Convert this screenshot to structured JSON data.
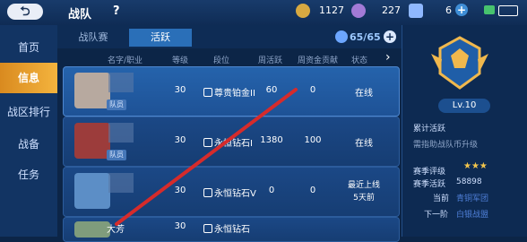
{
  "header": {
    "back_icon": "back-arrow-icon",
    "title": "战队",
    "help": "?",
    "gold": "1127",
    "gems": "227",
    "tickets": "6",
    "gold_icon": "coin-icon",
    "gem_icon": "diamond-icon",
    "ticket_icon": "card-icon",
    "plus": "+"
  },
  "sidebar": {
    "items": [
      {
        "label": "首页"
      },
      {
        "label": "信息"
      },
      {
        "label": "战区排行"
      },
      {
        "label": "战备"
      },
      {
        "label": "任务"
      }
    ]
  },
  "tabs": {
    "items": [
      {
        "label": "战队赛"
      },
      {
        "label": "活跃"
      }
    ],
    "member_count": "65/65"
  },
  "table": {
    "headers": [
      "名字/职业",
      "等级",
      "段位",
      "周活跃",
      "周资金贡献",
      "状态"
    ],
    "rows": [
      {
        "badge": "队员",
        "level": "30",
        "rank": "尊贵铂金II",
        "active": "60",
        "fund": "0",
        "status": "在线"
      },
      {
        "badge": "队员",
        "level": "30",
        "rank": "永恒钻石I",
        "active": "1380",
        "fund": "100",
        "status": "在线"
      },
      {
        "badge": "",
        "level": "30",
        "rank": "永恒钻石V",
        "active": "0",
        "fund": "0",
        "status_line1": "最近上线",
        "status_line2": "5天前"
      },
      {
        "name": "大芳",
        "level": "30",
        "rank": "永恒钻石",
        "active": "",
        "fund": "",
        "status": ""
      }
    ]
  },
  "right_panel": {
    "level": "Lv.10",
    "accum_label": "累计活跃",
    "need_text": "需指助战队币升级",
    "season_label": "赛季评级",
    "season_active_label": "赛季活跃",
    "season_active_value": "58898",
    "current_label": "当前",
    "current_value": "青铜军团",
    "next_label": "下一阶",
    "next_value": "白银战盟"
  }
}
